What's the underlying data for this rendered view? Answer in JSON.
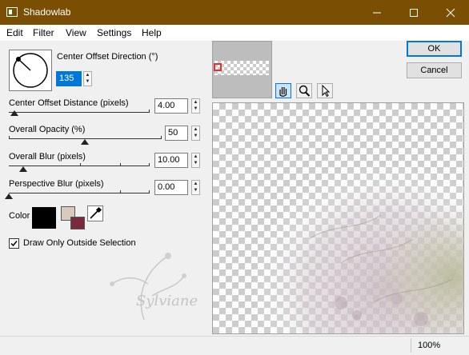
{
  "window": {
    "title": "Shadowlab"
  },
  "menu": [
    "Edit",
    "Filter",
    "View",
    "Settings",
    "Help"
  ],
  "direction": {
    "label": "Center Offset Direction (°)",
    "value": "135"
  },
  "distance": {
    "label": "Center Offset Distance (pixels)",
    "value": "4.00",
    "slider_fraction": 0.04
  },
  "opacity": {
    "label": "Overall Opacity (%)",
    "value": "50",
    "slider_fraction": 0.5
  },
  "blur": {
    "label": "Overall Blur (pixels)",
    "value": "10.00",
    "slider_fraction": 0.1
  },
  "perspective": {
    "label": "Perspective Blur (pixels)",
    "value": "0.00",
    "slider_fraction": 0.0
  },
  "color": {
    "label": "Color",
    "shadow_color": "#000000",
    "background_color": "#d8cbbe",
    "foreground_color": "#7b2a3e"
  },
  "checkbox": {
    "label": "Draw Only Outside Selection",
    "checked": true
  },
  "buttons": {
    "ok": "OK",
    "cancel": "Cancel"
  },
  "watermark": "Sylviane",
  "status": {
    "zoom": "100%"
  },
  "icons": [
    "hand-icon",
    "zoom-icon",
    "arrow-icon",
    "eyedropper-icon"
  ]
}
